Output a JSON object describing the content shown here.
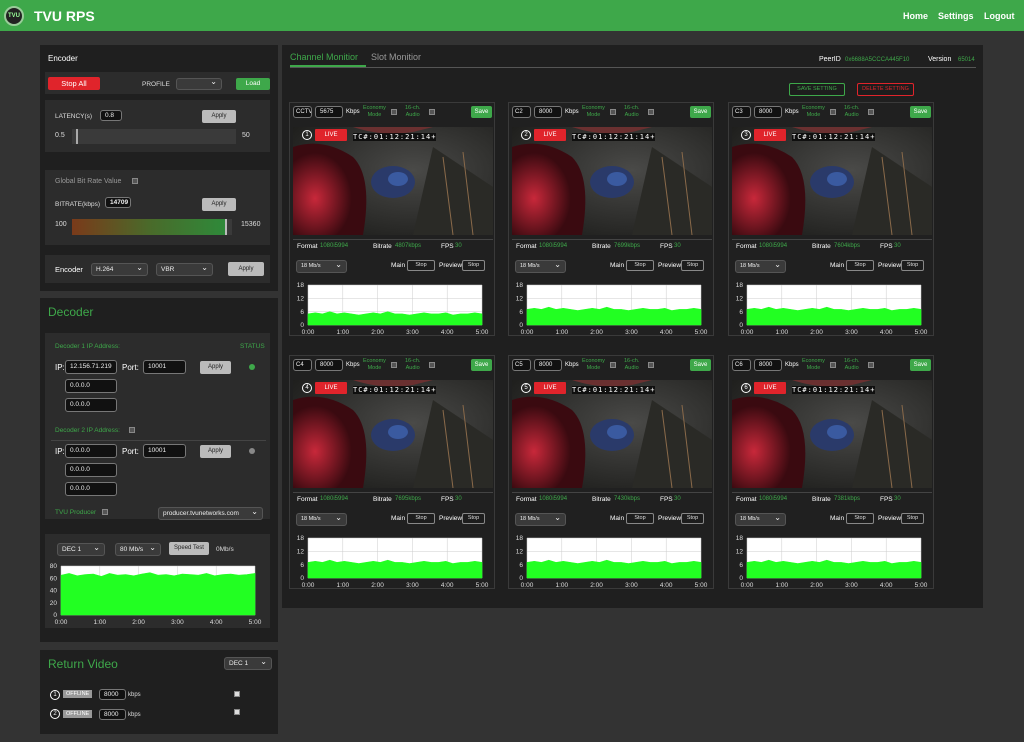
{
  "header": {
    "logo_text": "TVU",
    "title": "TVU RPS",
    "nav": [
      "Home",
      "Settings",
      "Logout"
    ]
  },
  "encoder": {
    "title": "Encoder",
    "stop_all": "Stop All",
    "profile_label": "PROFILE",
    "load": "Load",
    "latency_label": "LATENCY(s)",
    "latency_value": "0.8",
    "apply": "Apply",
    "latency_min": "0.5",
    "latency_max": "50",
    "latency_fraction": 0.03,
    "global_bitrate_label": "Global Bit Rate Value",
    "bitrate_label": "BITRATE(kbps)",
    "bitrate_value": "14709",
    "bitrate_min": "100",
    "bitrate_max": "15360",
    "bitrate_fraction": 0.96,
    "encoder_label": "Encoder",
    "codec": "H.264",
    "mode": "VBR"
  },
  "decoder": {
    "title": "Decoder",
    "dec1_label": "Decoder 1 IP Address:",
    "status_label": "STATUS",
    "ip_label": "IP:",
    "port_label": "Port:",
    "dec1_ip": "12.156.71.219",
    "dec1_port": "10001",
    "dec1_ip2": "0.0.0.0",
    "dec1_ip3": "0.0.0.0",
    "dec2_label": "Decoder 2 IP Address:",
    "dec2_ip": "0.0.0.0",
    "dec2_port": "10001",
    "dec2_ip2": "0.0.0.0",
    "dec2_ip3": "0.0.0.0",
    "producer_label": "TVU Producer",
    "producer_url": "producer.tvunetworks.com",
    "dec_select": "DEC 1",
    "speed_select": "80 Mb/s",
    "speed_test": "Speed Test",
    "speed_value": "0Mb/s"
  },
  "return_video": {
    "title": "Return Video",
    "dec_select": "DEC 1",
    "rows": [
      {
        "n": "1",
        "status": "OFFLINE",
        "kbps": "8000",
        "unit": "kbps"
      },
      {
        "n": "2",
        "status": "OFFLINE",
        "kbps": "8000",
        "unit": "kbps"
      }
    ]
  },
  "main": {
    "tabs": [
      "Channel Monitior",
      "Slot Monitior"
    ],
    "peer_label": "PeerID",
    "peer_value": "0x6688A5CCCA445F10",
    "version_label": "Version",
    "version_value": "65014",
    "save_setting": "SAVE SETTING",
    "delete_setting": "DELETE SETTING"
  },
  "channel_common": {
    "kbps": "Kbps",
    "economy": "Economy",
    "mode": "Mode",
    "audio16": "16-ch.",
    "audio": "Audio",
    "save": "Save",
    "live": "LIVE",
    "timecode": "TC#:01:12:21:14+",
    "format_label": "Format",
    "format_value": "1080i5994",
    "bitrate_label": "Bitrate",
    "fps_label": "FPS",
    "fps_value": "30",
    "rate_select": "18 Mb/s",
    "main_label": "Main",
    "preview_label": "Preview",
    "stop": "Stop"
  },
  "channels": [
    {
      "name": "CCTV",
      "kbps": "5675",
      "n": "1",
      "bitrate": "4807kbps"
    },
    {
      "name": "C2",
      "kbps": "8000",
      "n": "2",
      "bitrate": "7699kbps"
    },
    {
      "name": "C3",
      "kbps": "8000",
      "n": "3",
      "bitrate": "7604kbps"
    },
    {
      "name": "C4",
      "kbps": "8000",
      "n": "4",
      "bitrate": "7695kbps"
    },
    {
      "name": "C5",
      "kbps": "8000",
      "n": "5",
      "bitrate": "7430kbps"
    },
    {
      "name": "C6",
      "kbps": "8000",
      "n": "6",
      "bitrate": "7381kbps"
    }
  ],
  "chart_data": [
    {
      "type": "area",
      "title": "",
      "xlabel": "",
      "ylabel": "",
      "x_ticks": [
        "0:00",
        "1:00",
        "2:00",
        "3:00",
        "4:00",
        "5:00"
      ],
      "y_ticks": [
        0,
        6,
        12,
        18
      ],
      "ylim": [
        0,
        18
      ],
      "series": [
        {
          "values": [
            5,
            5.5,
            5,
            6,
            5,
            5.5,
            5,
            4.5,
            5,
            5.5,
            5,
            6,
            5,
            5,
            4.5,
            5,
            5.5,
            5,
            5,
            5.5,
            4.5,
            5,
            5,
            5.5,
            5
          ]
        }
      ],
      "color": "#22ff22"
    },
    {
      "type": "area",
      "title": "",
      "xlabel": "",
      "ylabel": "",
      "x_ticks": [
        "0:00",
        "1:00",
        "2:00",
        "3:00",
        "4:00",
        "5:00"
      ],
      "y_ticks": [
        0,
        6,
        12,
        18
      ],
      "ylim": [
        0,
        18
      ],
      "series": [
        {
          "values": [
            7,
            7.5,
            7,
            8,
            7,
            7.5,
            7,
            6.5,
            7,
            7.5,
            7,
            8,
            7,
            7,
            6.5,
            7,
            7.5,
            7,
            7,
            7.5,
            6.5,
            7,
            7,
            7.5,
            7
          ]
        }
      ],
      "color": "#22ff22"
    },
    {
      "type": "area",
      "title": "",
      "xlabel": "",
      "ylabel": "",
      "x_ticks": [
        "0:00",
        "1:00",
        "2:00",
        "3:00",
        "4:00",
        "5:00"
      ],
      "y_ticks": [
        0,
        6,
        12,
        18
      ],
      "ylim": [
        0,
        18
      ],
      "series": [
        {
          "values": [
            7,
            7.5,
            7,
            8,
            7,
            7.5,
            7,
            6.5,
            7,
            7.5,
            7,
            8,
            7,
            7,
            6.5,
            7,
            7.5,
            7,
            7,
            7.5,
            6.5,
            7,
            7,
            7.5,
            7
          ]
        }
      ],
      "color": "#22ff22"
    },
    {
      "type": "area",
      "title": "",
      "xlabel": "",
      "ylabel": "",
      "x_ticks": [
        "0:00",
        "1:00",
        "2:00",
        "3:00",
        "4:00",
        "5:00"
      ],
      "y_ticks": [
        0,
        6,
        12,
        18
      ],
      "ylim": [
        0,
        18
      ],
      "series": [
        {
          "values": [
            7,
            7.5,
            7,
            8,
            7,
            7.5,
            7,
            6.5,
            7,
            7.5,
            7,
            8,
            7,
            7,
            6.5,
            7,
            7.5,
            7,
            7,
            7.5,
            6.5,
            7,
            7,
            7.5,
            7
          ]
        }
      ],
      "color": "#22ff22"
    },
    {
      "type": "area",
      "title": "",
      "xlabel": "",
      "ylabel": "",
      "x_ticks": [
        "0:00",
        "1:00",
        "2:00",
        "3:00",
        "4:00",
        "5:00"
      ],
      "y_ticks": [
        0,
        6,
        12,
        18
      ],
      "ylim": [
        0,
        18
      ],
      "series": [
        {
          "values": [
            7,
            7.5,
            7,
            8,
            7,
            7.5,
            7,
            6.5,
            7,
            7.5,
            7,
            8,
            7,
            7,
            6.5,
            7,
            7.5,
            7,
            7,
            7.5,
            6.5,
            7,
            7,
            7.5,
            7
          ]
        }
      ],
      "color": "#22ff22"
    },
    {
      "type": "area",
      "title": "",
      "xlabel": "",
      "ylabel": "",
      "x_ticks": [
        "0:00",
        "1:00",
        "2:00",
        "3:00",
        "4:00",
        "5:00"
      ],
      "y_ticks": [
        0,
        6,
        12,
        18
      ],
      "ylim": [
        0,
        18
      ],
      "series": [
        {
          "values": [
            7,
            7.5,
            7,
            8,
            7,
            7.5,
            7,
            6.5,
            7,
            7.5,
            7,
            8,
            7,
            7,
            6.5,
            7,
            7.5,
            7,
            7,
            7.5,
            6.5,
            7,
            7,
            7.5,
            7
          ]
        }
      ],
      "color": "#22ff22"
    },
    {
      "type": "area",
      "title": "",
      "xlabel": "",
      "ylabel": "",
      "x_ticks": [
        "0:00",
        "1:00",
        "2:00",
        "3:00",
        "4:00",
        "5:00"
      ],
      "y_ticks": [
        0,
        20,
        40,
        60,
        80
      ],
      "ylim": [
        0,
        80
      ],
      "series": [
        {
          "values": [
            65,
            68,
            64,
            66,
            67,
            63,
            68,
            65,
            66,
            64,
            67,
            69,
            65,
            66,
            64,
            67,
            66,
            65,
            68,
            64,
            66,
            67,
            65,
            66,
            68
          ]
        }
      ],
      "color": "#22ff22"
    }
  ]
}
